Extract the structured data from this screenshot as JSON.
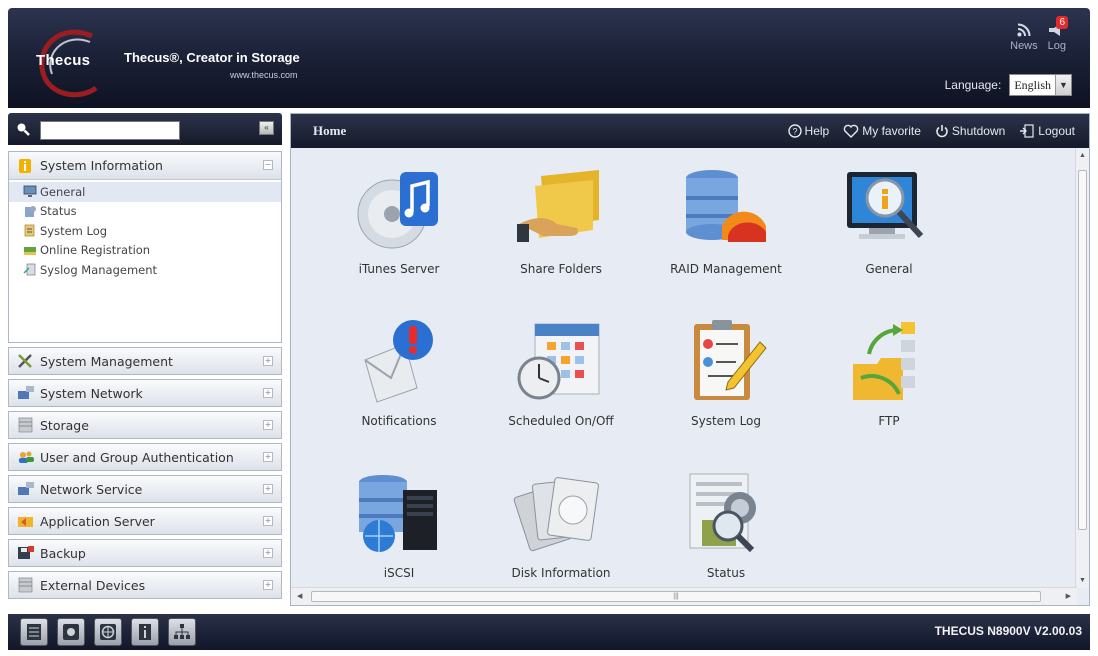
{
  "header": {
    "brand": "Thecus",
    "slogan": "Thecus®, Creator in Storage",
    "site": "www.thecus.com",
    "news_label": "News",
    "log_label": "Log",
    "log_badge": "6",
    "language_label": "Language:",
    "language_value": "English"
  },
  "sidebar": {
    "search_value": "",
    "sections": [
      {
        "label": "System Information",
        "expanded": true,
        "items": [
          {
            "label": "General",
            "active": true
          },
          {
            "label": "Status"
          },
          {
            "label": "System Log"
          },
          {
            "label": "Online Registration"
          },
          {
            "label": "Syslog Management"
          }
        ]
      },
      {
        "label": "System Management"
      },
      {
        "label": "System Network"
      },
      {
        "label": "Storage"
      },
      {
        "label": "User and Group Authentication"
      },
      {
        "label": "Network Service"
      },
      {
        "label": "Application Server"
      },
      {
        "label": "Backup"
      },
      {
        "label": "External Devices"
      }
    ]
  },
  "toolbar": {
    "home": "Home",
    "help": "Help",
    "favorite": "My favorite",
    "shutdown": "Shutdown",
    "logout": "Logout"
  },
  "apps": [
    {
      "label": "iTunes Server",
      "icon": "itunes-icon"
    },
    {
      "label": "Share Folders",
      "icon": "share-folders-icon"
    },
    {
      "label": "RAID Management",
      "icon": "raid-icon"
    },
    {
      "label": "General",
      "icon": "general-monitor-icon"
    },
    {
      "label": "Notifications",
      "icon": "notifications-icon"
    },
    {
      "label": "Scheduled On/Off",
      "icon": "schedule-icon"
    },
    {
      "label": "System Log",
      "icon": "system-log-icon"
    },
    {
      "label": "FTP",
      "icon": "ftp-icon"
    },
    {
      "label": "iSCSI",
      "icon": "iscsi-icon"
    },
    {
      "label": "Disk Information",
      "icon": "disk-info-icon"
    },
    {
      "label": "Status",
      "icon": "status-icon"
    }
  ],
  "footer": {
    "version": "THECUS N8900V V2.00.03"
  }
}
